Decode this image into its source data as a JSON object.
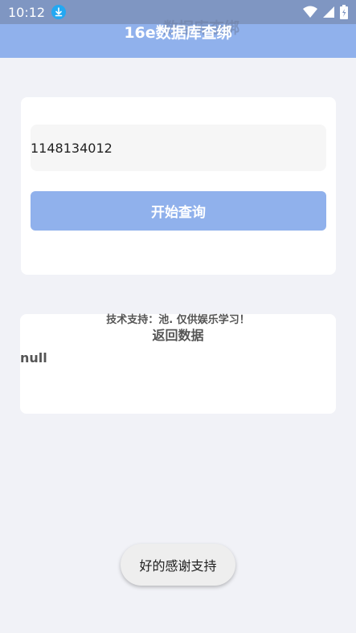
{
  "status_bar": {
    "time": "10:12",
    "icons": [
      "download-icon",
      "wifi-icon",
      "signal-icon",
      "battery-icon"
    ]
  },
  "header": {
    "title": "16e数据库查绑",
    "ghost_title": "数据库查绑"
  },
  "query": {
    "input_value": "1148134012",
    "button_label": "开始查询"
  },
  "result": {
    "support_text": "技术支持：池. 仅供娱乐学习！",
    "title": "返回数据",
    "value": "null"
  },
  "toast": {
    "text": "好的感谢支持"
  },
  "colors": {
    "accent": "#90b1ec",
    "status_bar": "#7f96c2",
    "background": "#f1f2f7"
  }
}
